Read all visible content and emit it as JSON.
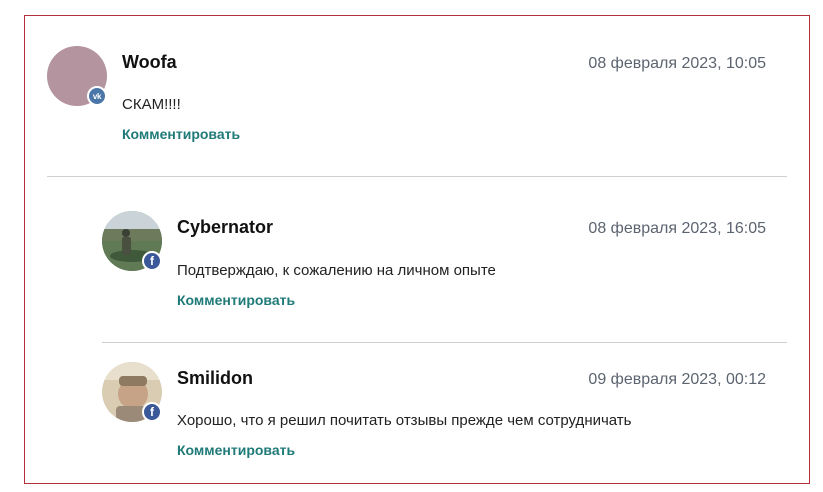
{
  "comments": [
    {
      "author": "Woofa",
      "date": "08 февраля 2023, 10:05",
      "text": "СКАМ!!!!",
      "reply_label": "Комментировать",
      "network": "vk",
      "network_glyph": "vk",
      "avatar_color": "#b3949f"
    },
    {
      "author": "Cybernator",
      "date": "08 февраля 2023, 16:05",
      "text": "Подтверждаю, к сожалению на личном опыте",
      "reply_label": "Комментировать",
      "network": "facebook",
      "network_glyph": "f"
    },
    {
      "author": "Smilidon",
      "date": "09 февраля 2023, 00:12",
      "text": "Хорошо, что я решил почитать отзывы прежде чем сотрудничать",
      "reply_label": "Комментировать",
      "network": "facebook",
      "network_glyph": "f"
    }
  ],
  "colors": {
    "border": "#b3303a",
    "link": "#1f7a78",
    "date": "#5c6470",
    "divider": "#cfcfcf",
    "vk_badge": "#4a76a8",
    "fb_badge": "#3b5998"
  }
}
